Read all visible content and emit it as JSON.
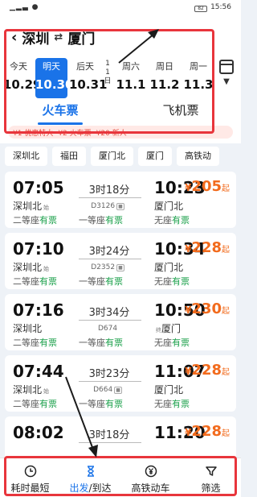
{
  "status": {
    "left": "▁▂▃ ●",
    "battery": "82",
    "time": "15:56"
  },
  "route": {
    "from": "深圳",
    "swap": "⇄",
    "to": "厦门"
  },
  "dates": [
    {
      "wd": "今天",
      "dd": "10.29",
      "selected": false
    },
    {
      "wd": "明天",
      "dd": "10.30",
      "selected": true
    },
    {
      "wd": "后天",
      "dd": "10.31",
      "selected": false
    },
    {
      "wd": "1",
      "dd": "1",
      "extra": "日",
      "vertical": true
    },
    {
      "wd": "周六",
      "dd": "11.1",
      "selected": false
    },
    {
      "wd": "周日",
      "dd": "11.2",
      "selected": false
    },
    {
      "wd": "周一",
      "dd": "11.3",
      "selected": false
    }
  ],
  "modes": {
    "train": "火车票",
    "flight": "飞机票"
  },
  "promo": [
    "¥1 优惠特大",
    "¥2 火车票",
    "¥20 新人"
  ],
  "stations": [
    "深圳北",
    "福田",
    "厦门北",
    "厦门",
    "高铁动"
  ],
  "trains": [
    {
      "dep": "07:05",
      "arr": "10:23",
      "dur": "3时18分",
      "code": "D3126",
      "from": "深圳北",
      "from_tag": "始",
      "to": "厦门北",
      "to_tag": "",
      "price": "205",
      "s1": "二等座",
      "s2": "一等座",
      "s3": "无座"
    },
    {
      "dep": "07:10",
      "arr": "10:34",
      "dur": "3时24分",
      "code": "D2352",
      "from": "深圳北",
      "from_tag": "始",
      "to": "厦门北",
      "to_tag": "",
      "price": "228",
      "s1": "二等座",
      "s2": "一等座",
      "s3": "无座"
    },
    {
      "dep": "07:16",
      "arr": "10:50",
      "dur": "3时34分",
      "code": "D674",
      "from": "深圳北",
      "from_tag": "",
      "to": "厦门",
      "to_tag": "终",
      "price": "230",
      "s1": "二等座",
      "s2": "一等座",
      "s3": "无座"
    },
    {
      "dep": "07:44",
      "arr": "11:07",
      "dur": "3时23分",
      "code": "D664",
      "from": "深圳北",
      "from_tag": "始",
      "to": "厦门北",
      "to_tag": "",
      "price": "228",
      "s1": "二等座",
      "s2": "一等座",
      "s3": "无座"
    },
    {
      "dep": "08:02",
      "arr": "11:20",
      "dur": "3时18分",
      "code": "",
      "from": "",
      "from_tag": "",
      "to": "",
      "to_tag": "",
      "price": "228",
      "s1": "",
      "s2": "",
      "s3": ""
    }
  ],
  "seat_status": "有票",
  "price_prefix": "¥",
  "price_suffix": "起",
  "bottom": {
    "t1": "耗时最短",
    "t2a": "出发",
    "t2b": "/到达",
    "t3": "高铁动车",
    "t4": "筛选"
  },
  "colors": {
    "accent": "#1a73e8",
    "price": "#f26b1d",
    "available": "#1aa04a",
    "annotation": "#e8353c"
  }
}
